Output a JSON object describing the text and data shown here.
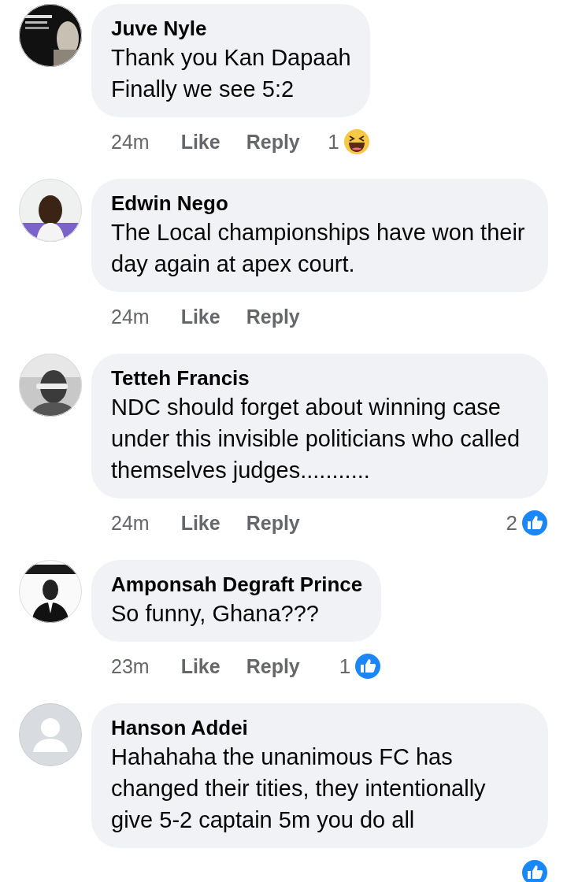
{
  "comments": [
    {
      "name": "Juve Nyle",
      "text": "Thank you Kan Dapaah\nFinally we see 5:2",
      "time": "24m",
      "actions": [
        "Like",
        "Reply"
      ],
      "reaction": {
        "kind": "haha",
        "count": "1"
      }
    },
    {
      "name": "Edwin Nego",
      "text": "The Local championships have won their day again at apex court.",
      "time": "24m",
      "actions": [
        "Like",
        "Reply"
      ]
    },
    {
      "name": "Tetteh Francis",
      "text": "NDC should forget about winning case under this invisible politicians who called themselves judges...........",
      "time": "24m",
      "actions": [
        "Like",
        "Reply"
      ],
      "reaction": {
        "kind": "like",
        "count": "2"
      }
    },
    {
      "name": "Amponsah Degraft Prince",
      "text": "So funny, Ghana???",
      "time": "23m",
      "actions": [
        "Like",
        "Reply"
      ],
      "reaction": {
        "kind": "like",
        "count": "1"
      }
    },
    {
      "avatar": {
        "kind": "default"
      },
      "name": "Hanson Addei",
      "text": "Hahahaha the unanimous FC has changed their tities, they intentionally give 5-2 captain 5m you do all",
      "reaction": {
        "kind": "like"
      }
    }
  ]
}
